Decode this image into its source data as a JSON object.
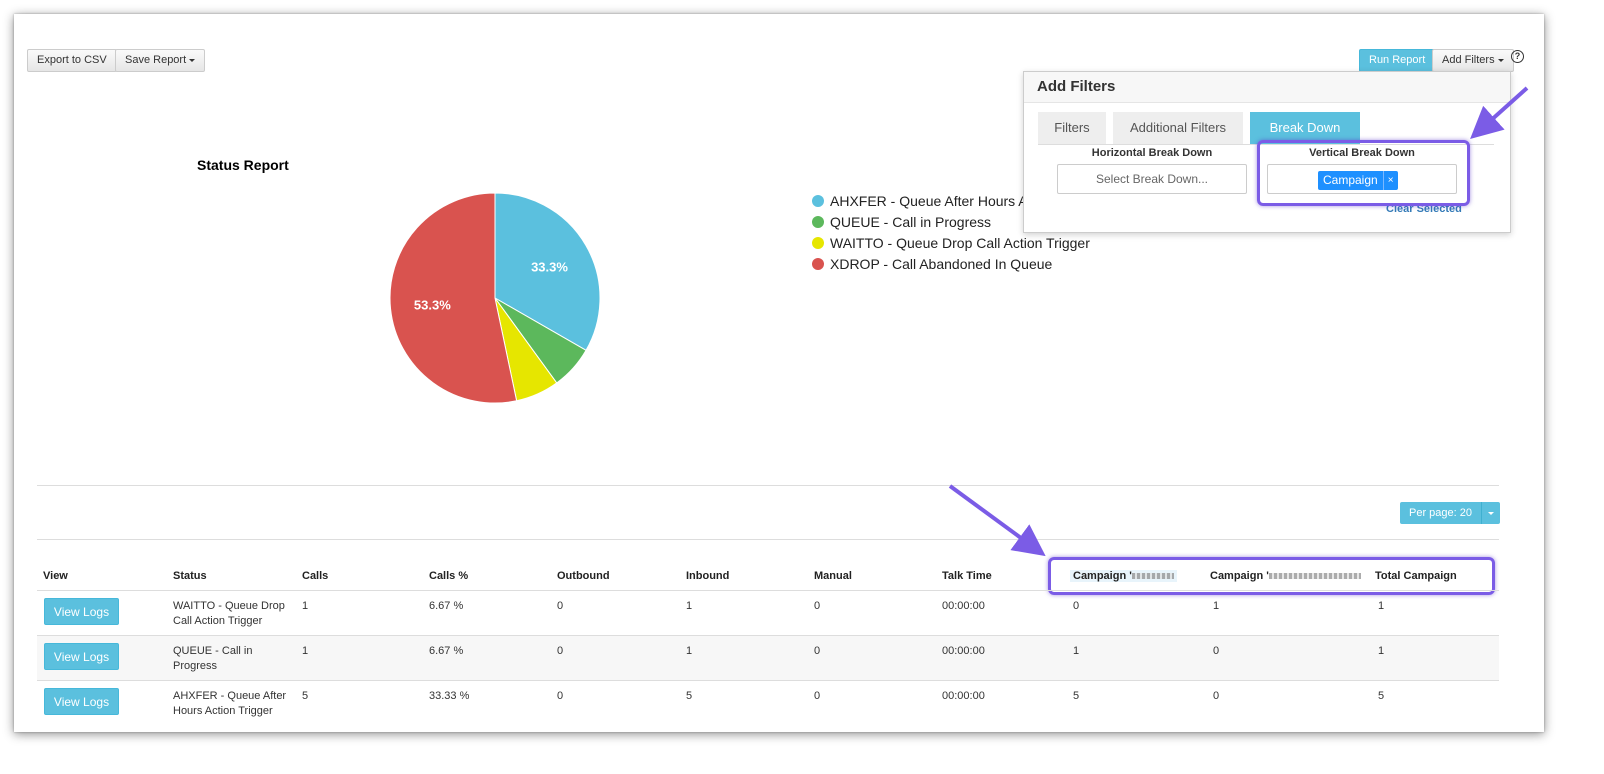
{
  "toolbar": {
    "export_label": "Export to CSV",
    "save_label": "Save Report",
    "run_label": "Run Report",
    "add_filters_label": "Add Filters",
    "help_label": "?"
  },
  "chart_data": {
    "type": "pie",
    "title": "Status Report",
    "categories": [
      "AHXFER - Queue After Hours Ac",
      "QUEUE - Call in Progress",
      "WAITTO - Queue Drop Call Action Trigger",
      "XDROP - Call Abandoned In Queue"
    ],
    "values": [
      33.3,
      6.7,
      6.7,
      53.3
    ],
    "data_labels": [
      "33.3%",
      "",
      "",
      "53.3%"
    ],
    "colors": [
      "#5bc0de",
      "#5cb85c",
      "#e6e600",
      "#d9534f"
    ],
    "legend_position": "right"
  },
  "filters": {
    "title": "Add Filters",
    "tabs": [
      "Filters",
      "Additional Filters",
      "Break Down"
    ],
    "horizontal_label": "Horizontal Break Down",
    "horizontal_placeholder": "Select Break Down...",
    "vertical_label": "Vertical Break Down",
    "vertical_chip": "Campaign",
    "chip_remove": "×",
    "clear_label": "Clear Selected"
  },
  "per_page_label": "Per page: 20",
  "table": {
    "headers": [
      "View",
      "Status",
      "Calls",
      "Calls %",
      "Outbound",
      "Inbound",
      "Manual",
      "Talk Time",
      "Campaign '",
      "Campaign '",
      "Total Campaign"
    ],
    "view_button": "View Logs",
    "rows": [
      {
        "status": "WAITTO - Queue Drop Call Action Trigger",
        "calls": "1",
        "calls_pct": "6.67 %",
        "outbound": "0",
        "inbound": "1",
        "manual": "0",
        "talk_time": "00:00:00",
        "campaign_1": "0",
        "campaign_2": "1",
        "total": "1"
      },
      {
        "status": "QUEUE - Call in Progress",
        "calls": "1",
        "calls_pct": "6.67 %",
        "outbound": "0",
        "inbound": "1",
        "manual": "0",
        "talk_time": "00:00:00",
        "campaign_1": "1",
        "campaign_2": "0",
        "total": "1"
      },
      {
        "status": "AHXFER - Queue After Hours Action Trigger",
        "calls": "5",
        "calls_pct": "33.33 %",
        "outbound": "0",
        "inbound": "5",
        "manual": "0",
        "talk_time": "00:00:00",
        "campaign_1": "5",
        "campaign_2": "0",
        "total": "5"
      }
    ]
  }
}
